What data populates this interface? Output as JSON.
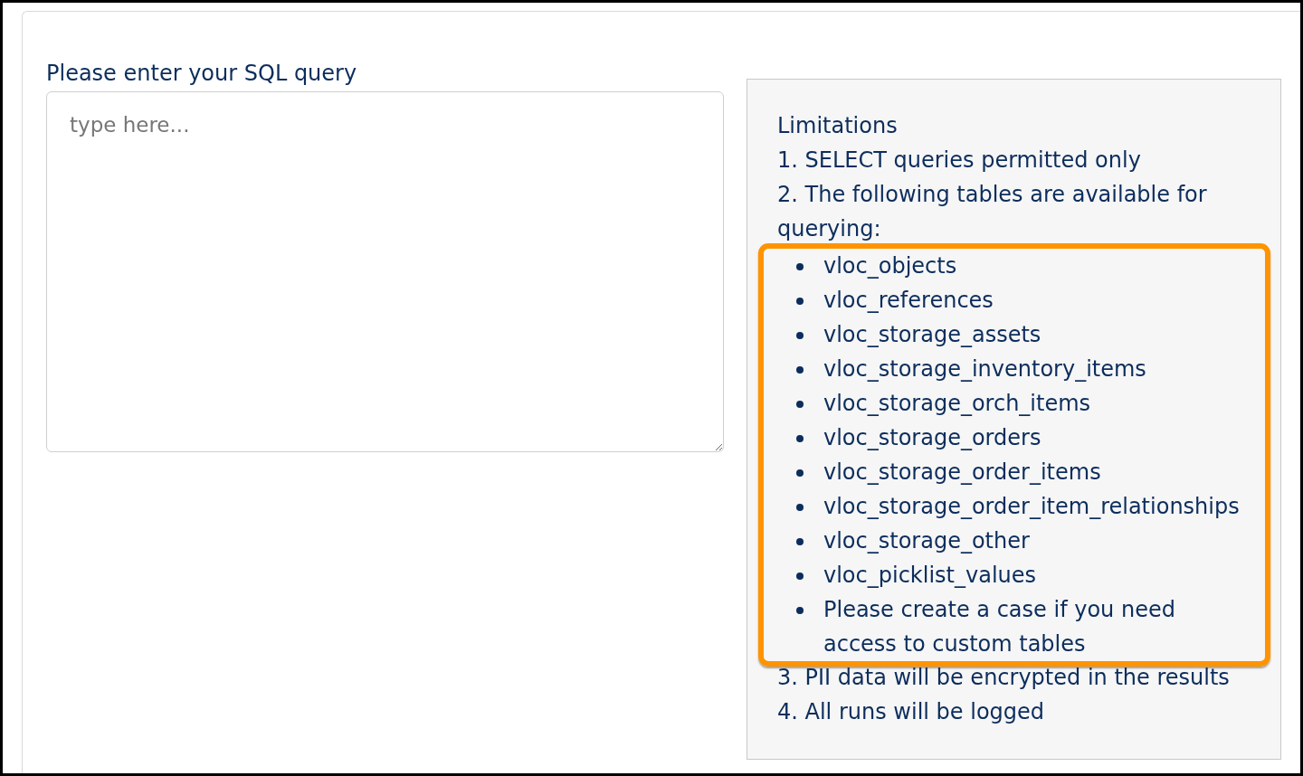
{
  "query_form": {
    "label": "Please enter your SQL query",
    "query_field": {
      "placeholder": "type here..."
    }
  },
  "limitations": {
    "title": "Limitations",
    "items": [
      {
        "text": "1. SELECT queries permitted only"
      },
      {
        "text": "2. The following tables are available for querying:",
        "tables": {
          "highlighted": true,
          "items": [
            "vloc_objects",
            "vloc_references",
            "vloc_storage_assets",
            "vloc_storage_inventory_items",
            "vloc_storage_orch_items",
            "vloc_storage_orders",
            "vloc_storage_order_items",
            "vloc_storage_order_item_relationships",
            "vloc_storage_other",
            "vloc_picklist_values",
            "Please create a case if you need access to custom tables"
          ]
        }
      },
      {
        "text": "3. PII data will be encrypted in the results"
      },
      {
        "text": "4. All runs will be logged"
      }
    ]
  }
}
